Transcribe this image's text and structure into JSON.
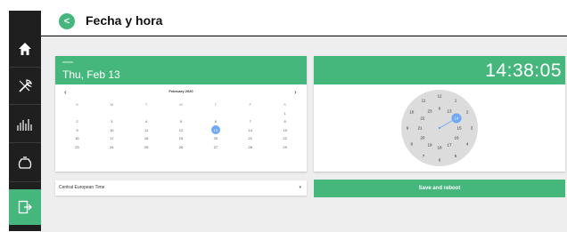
{
  "header": {
    "title": "Fecha y hora",
    "back_label": "<"
  },
  "sidebar": {
    "items": [
      {
        "icon": "home-icon"
      },
      {
        "icon": "tools-icon"
      },
      {
        "icon": "equalizer-icon"
      },
      {
        "icon": "coffee-pot-icon"
      },
      {
        "icon": "exit-icon",
        "active": true
      }
    ]
  },
  "date_picker": {
    "display": "Thu, Feb 13",
    "month_label": "February 2020",
    "prev": "‹",
    "next": "›",
    "weekdays": [
      "S",
      "M",
      "T",
      "W",
      "T",
      "F",
      "S"
    ],
    "weeks": [
      [
        "",
        "",
        "",
        "",
        "",
        "",
        "1"
      ],
      [
        "2",
        "3",
        "4",
        "5",
        "6",
        "7",
        "8"
      ],
      [
        "9",
        "10",
        "11",
        "12",
        "13",
        "14",
        "15"
      ],
      [
        "16",
        "17",
        "18",
        "19",
        "20",
        "21",
        "22"
      ],
      [
        "23",
        "24",
        "25",
        "26",
        "27",
        "28",
        "29"
      ]
    ],
    "selected": "13"
  },
  "time_picker": {
    "display_hour": "14",
    "display_sep": ":38:05",
    "outer_numbers": [
      "12",
      "1",
      "2",
      "3",
      "4",
      "5",
      "6",
      "7",
      "8",
      "9",
      "10",
      "11"
    ],
    "inner_numbers": [
      "0",
      "13",
      "14",
      "15",
      "16",
      "17",
      "18",
      "19",
      "20",
      "21",
      "22",
      "23"
    ],
    "selected": "14"
  },
  "timezone": {
    "value": "Central European Time",
    "caret": "▾"
  },
  "actions": {
    "save_reboot": "Save and reboot"
  },
  "colors": {
    "accent": "#45b77d",
    "sidebar": "#1f1f1f",
    "selected": "#6ea8f7"
  }
}
